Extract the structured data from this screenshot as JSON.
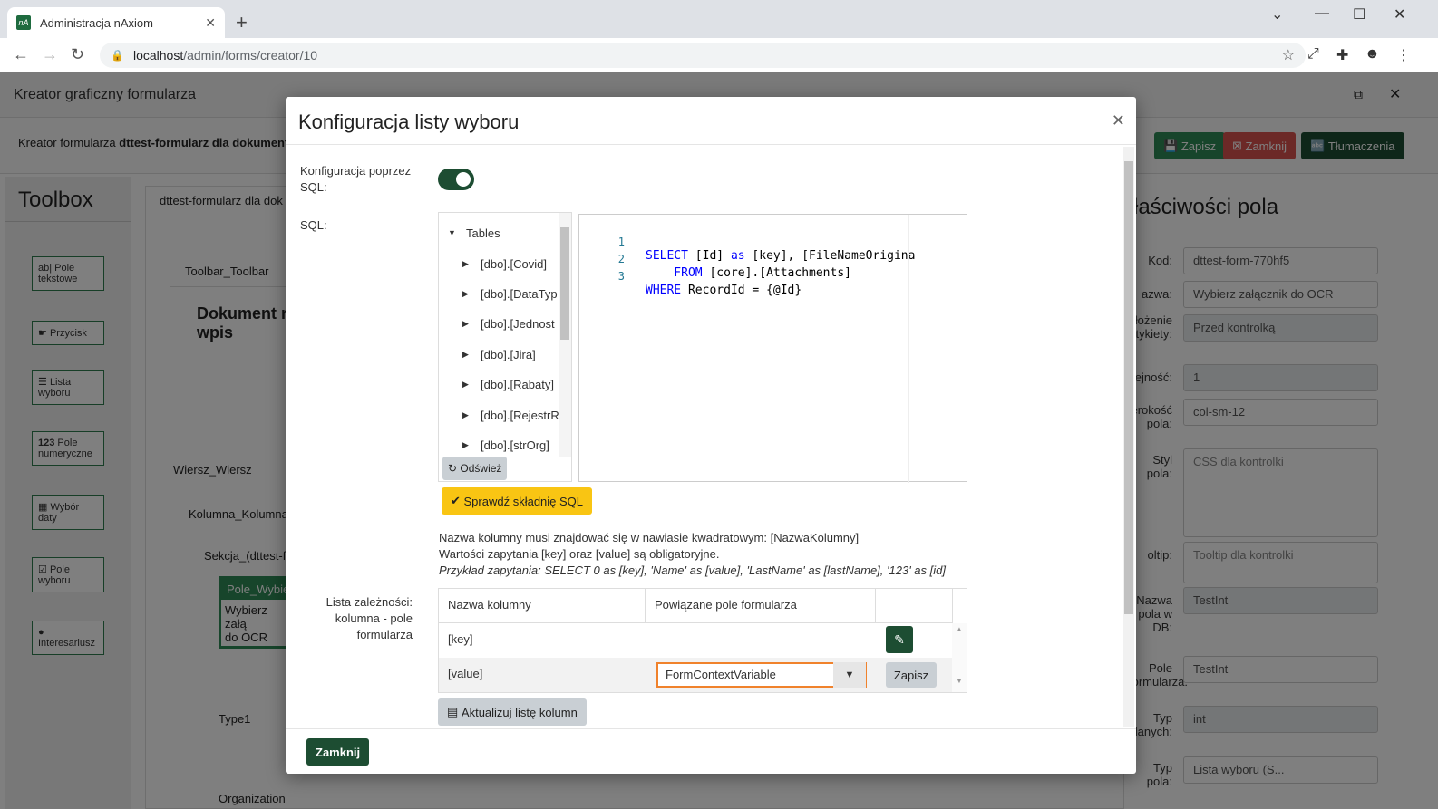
{
  "browser": {
    "tab_title": "Administracja nAxiom",
    "favicon_text": "nA",
    "url_host": "localhost",
    "url_path": "/admin/forms/creator/10"
  },
  "app": {
    "title": "Kreator graficzny formularza",
    "subtitle_prefix": "Kreator formularza ",
    "subtitle_form": "dttest-formularz dla dokument",
    "buttons": {
      "save": "Zapisz",
      "close": "Zamknij",
      "translations": "Tłumaczenia"
    },
    "toolbox_title": "Toolbox",
    "toolbox_items": [
      {
        "icon": "ab|",
        "label": "Pole tekstowe"
      },
      {
        "icon": "☛",
        "label": "Przycisk"
      },
      {
        "icon": "☰",
        "label": "Lista wyboru"
      },
      {
        "icon": "123",
        "label": "Pole numeryczne"
      },
      {
        "icon": "▦",
        "label": "Wybór daty"
      },
      {
        "icon": "☑",
        "label": "Pole wyboru"
      },
      {
        "icon": "●",
        "label": "Interesariusz"
      }
    ],
    "canvas": {
      "tab": "dttest-formularz dla dok",
      "toolbar": "Toolbar_Toolbar",
      "heading_line1": "Dokument r",
      "heading_line2": "wpis",
      "row": "Wiersz_Wiersz",
      "column": "Kolumna_Kolumna",
      "section": "Sekcja_(dttest-fo",
      "field_header": "Pole_Wybier",
      "field_text1": "Wybierz załą",
      "field_text2": "do OCR",
      "type_label": "Type1",
      "org_label": "Organization"
    },
    "properties": {
      "title": "łaściwości pola",
      "fields": [
        {
          "label": "Kod:",
          "value": "dttest-form-770hf5"
        },
        {
          "label": "azwa:",
          "value": "Wybierz załącznik do OCR"
        },
        {
          "label": "łożenie etykiety:",
          "value": "Przed kontrolką"
        },
        {
          "label": "lejność:",
          "value": "1"
        },
        {
          "label": "erokość pola:",
          "value": "col-sm-12"
        },
        {
          "label": "Styl pola:",
          "value": "CSS dla kontrolki"
        },
        {
          "label": "oltip:",
          "value": "Tooltip dla kontrolki"
        },
        {
          "label": "Nazwa pola w DB:",
          "value": "TestInt"
        },
        {
          "label": "Pole formularza:",
          "value": "TestInt"
        },
        {
          "label": "Typ danych:",
          "value": "int"
        },
        {
          "label": "Typ pola:",
          "value": "Lista wyboru (S..."
        }
      ]
    }
  },
  "modal": {
    "title": "Konfiguracja listy wyboru",
    "sql_toggle_label": "Konfiguracja poprzez SQL:",
    "sql_label": "SQL:",
    "tree_root": "Tables",
    "tree_items": [
      "[dbo].[Covid]",
      "[dbo].[DataTyp",
      "[dbo].[Jednost",
      "[dbo].[Jira]",
      "[dbo].[Rabaty]",
      "[dbo].[RejestrR",
      "[dbo].[strOrg]"
    ],
    "refresh_button": "Odśwież",
    "sql_lines": [
      {
        "num": "1",
        "kw": "SELECT",
        "rest": " [Id] ",
        "kw2": "as",
        "rest2": " [key], [FileNameOrigina"
      },
      {
        "num": "2",
        "kw": "    FROM",
        "rest": " [core].[Attachments]",
        "kw2": "",
        "rest2": ""
      },
      {
        "num": "3",
        "kw": "WHERE",
        "rest": " RecordId = {@Id}",
        "kw2": "",
        "rest2": ""
      }
    ],
    "check_button": "Sprawdź składnię SQL",
    "hint1": "Nazwa kolumny musi znajdować się w nawiasie kwadratowym: [NazwaKolumny]",
    "hint2": "Wartości zapytania [key] oraz [value] są obligatoryjne.",
    "hint3": "Przykład zapytania: SELECT 0 as [key], 'Name' as [value], 'LastName' as [lastName], '123' as [id]",
    "deps_label": "Lista zależności: kolumna - pole formularza",
    "table": {
      "col1": "Nazwa kolumny",
      "col2": "Powiązane pole formularza",
      "rows": [
        {
          "name": "[key]",
          "field": ""
        },
        {
          "name": "[value]",
          "field": "FormContextVariable"
        }
      ],
      "save_row": "Zapisz"
    },
    "update_button": "Aktualizuj listę kolumn",
    "close_button": "Zamknij"
  },
  "colors": {
    "primary": "#1d4d32",
    "save": "#2e8b57",
    "close": "#d9534f",
    "warning": "#f9c513",
    "focus": "#f0822c"
  }
}
